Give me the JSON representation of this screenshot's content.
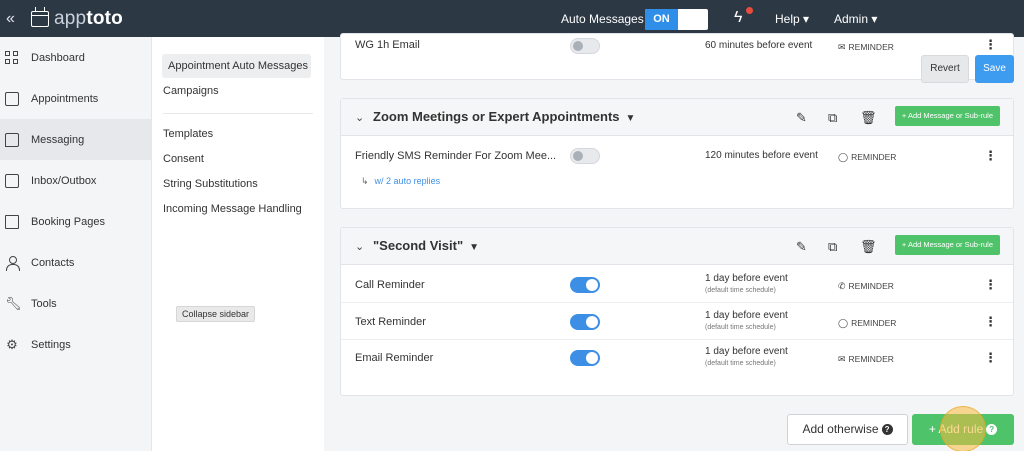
{
  "topbar": {
    "collapse_glyph": "«",
    "brand_part1": "app",
    "brand_part2": "toto",
    "auto_messages_label": "Auto Messages",
    "auto_messages_toggle": "ON",
    "help_label": "Help ▾",
    "admin_label": "Admin ▾"
  },
  "sidebar": {
    "items": [
      {
        "label": "Dashboard",
        "icon": "dashboard-icon"
      },
      {
        "label": "Appointments",
        "icon": "calendar-icon"
      },
      {
        "label": "Messaging",
        "icon": "chat-icon"
      },
      {
        "label": "Inbox/Outbox",
        "icon": "inbox-icon"
      },
      {
        "label": "Booking Pages",
        "icon": "book-icon"
      },
      {
        "label": "Contacts",
        "icon": "person-icon"
      },
      {
        "label": "Tools",
        "icon": "wrench-icon"
      },
      {
        "label": "Settings",
        "icon": "gear-icon"
      }
    ],
    "active": "Messaging"
  },
  "submenu": {
    "items": [
      "Appointment Auto Messages",
      "Campaigns",
      "Templates",
      "Consent",
      "String Substitutions",
      "Incoming Message Handling"
    ],
    "tooltip": "Collapse sidebar"
  },
  "top_panel": {
    "row": {
      "name": "WG 1h Email",
      "timing": "60 minutes before event",
      "kind": "REMINDER",
      "kind_icon": "mail-icon",
      "enabled": false
    },
    "revert_label": "Revert",
    "save_label": "Save"
  },
  "groups": [
    {
      "title": "Zoom Meetings or Expert Appointments",
      "add_label": "+ Add Message or Sub-rule",
      "rows": [
        {
          "name": "Friendly SMS Reminder For Zoom Mee...",
          "timing": "120 minutes before event",
          "kind": "REMINDER",
          "kind_icon": "chat-bubble-icon",
          "enabled": false,
          "replies": "w/ 2 auto replies"
        }
      ]
    },
    {
      "title": "\"Second Visit\"",
      "add_label": "+ Add Message or Sub-rule",
      "rows": [
        {
          "name": "Call Reminder",
          "timing": "1 day before event",
          "timing_sub": "(default time schedule)",
          "kind": "REMINDER",
          "kind_icon": "phone-icon",
          "enabled": true
        },
        {
          "name": "Text Reminder",
          "timing": "1 day before event",
          "timing_sub": "(default time schedule)",
          "kind": "REMINDER",
          "kind_icon": "chat-bubble-icon",
          "enabled": true
        },
        {
          "name": "Email Reminder",
          "timing": "1 day before event",
          "timing_sub": "(default time schedule)",
          "kind": "REMINDER",
          "kind_icon": "mail-icon",
          "enabled": true
        }
      ]
    }
  ],
  "footer": {
    "otherwise_label": "Add otherwise",
    "add_rule_label": "+ Add rule"
  },
  "colors": {
    "topbar": "#2d3845",
    "accent_blue": "#3d8fe6",
    "green": "#4fc36a"
  }
}
